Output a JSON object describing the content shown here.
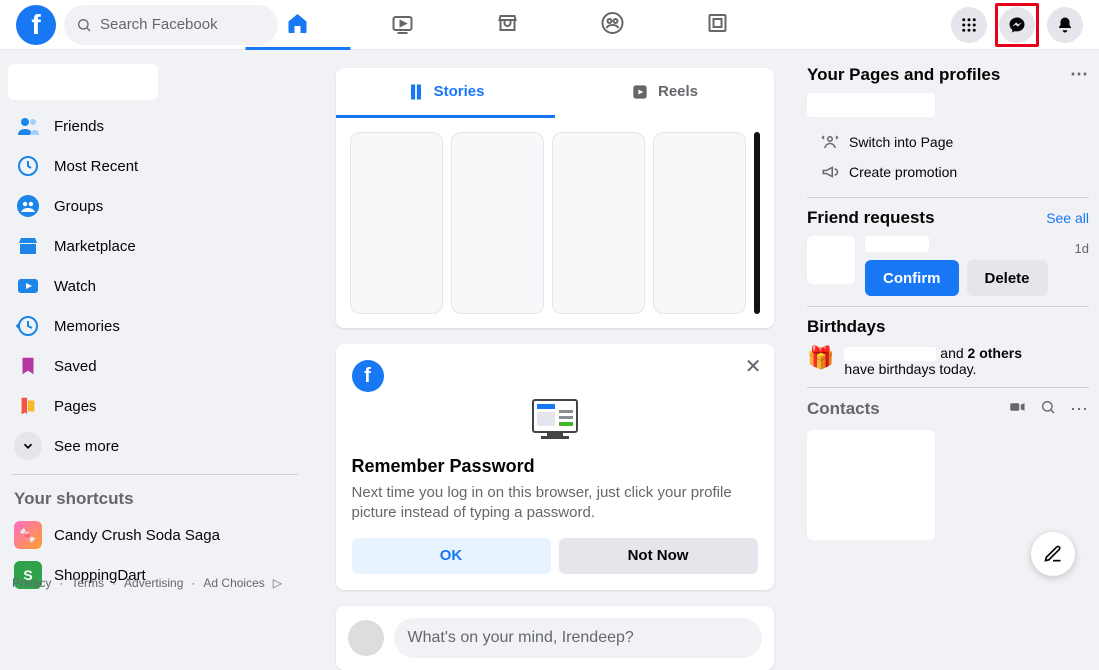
{
  "search": {
    "placeholder": "Search Facebook"
  },
  "leftnav": {
    "items": [
      {
        "label": "Friends"
      },
      {
        "label": "Most Recent"
      },
      {
        "label": "Groups"
      },
      {
        "label": "Marketplace"
      },
      {
        "label": "Watch"
      },
      {
        "label": "Memories"
      },
      {
        "label": "Saved"
      },
      {
        "label": "Pages"
      },
      {
        "label": "See more"
      }
    ],
    "shortcuts_title": "Your shortcuts",
    "shortcuts": [
      {
        "label": "Candy Crush Soda Saga"
      },
      {
        "label": "ShoppingDart"
      }
    ]
  },
  "stories": {
    "tab_stories": "Stories",
    "tab_reels": "Reels"
  },
  "remember": {
    "title": "Remember Password",
    "body": "Next time you log in on this browser, just click your profile picture instead of typing a password.",
    "ok": "OK",
    "notnow": "Not Now"
  },
  "composer": {
    "placeholder": "What's on your mind, Irendeep?"
  },
  "right": {
    "pages_title": "Your Pages and profiles",
    "switch": "Switch into Page",
    "promo": "Create promotion",
    "fr_title": "Friend requests",
    "see_all": "See all",
    "fr_time": "1d",
    "fr_confirm": "Confirm",
    "fr_delete": "Delete",
    "bd_title": "Birthdays",
    "bd_and": " and ",
    "bd_others": "2 others",
    "bd_tail": "have birthdays today.",
    "contacts_title": "Contacts"
  },
  "footer": [
    "Privacy",
    "Terms",
    "Advertising",
    "Ad Choices"
  ]
}
